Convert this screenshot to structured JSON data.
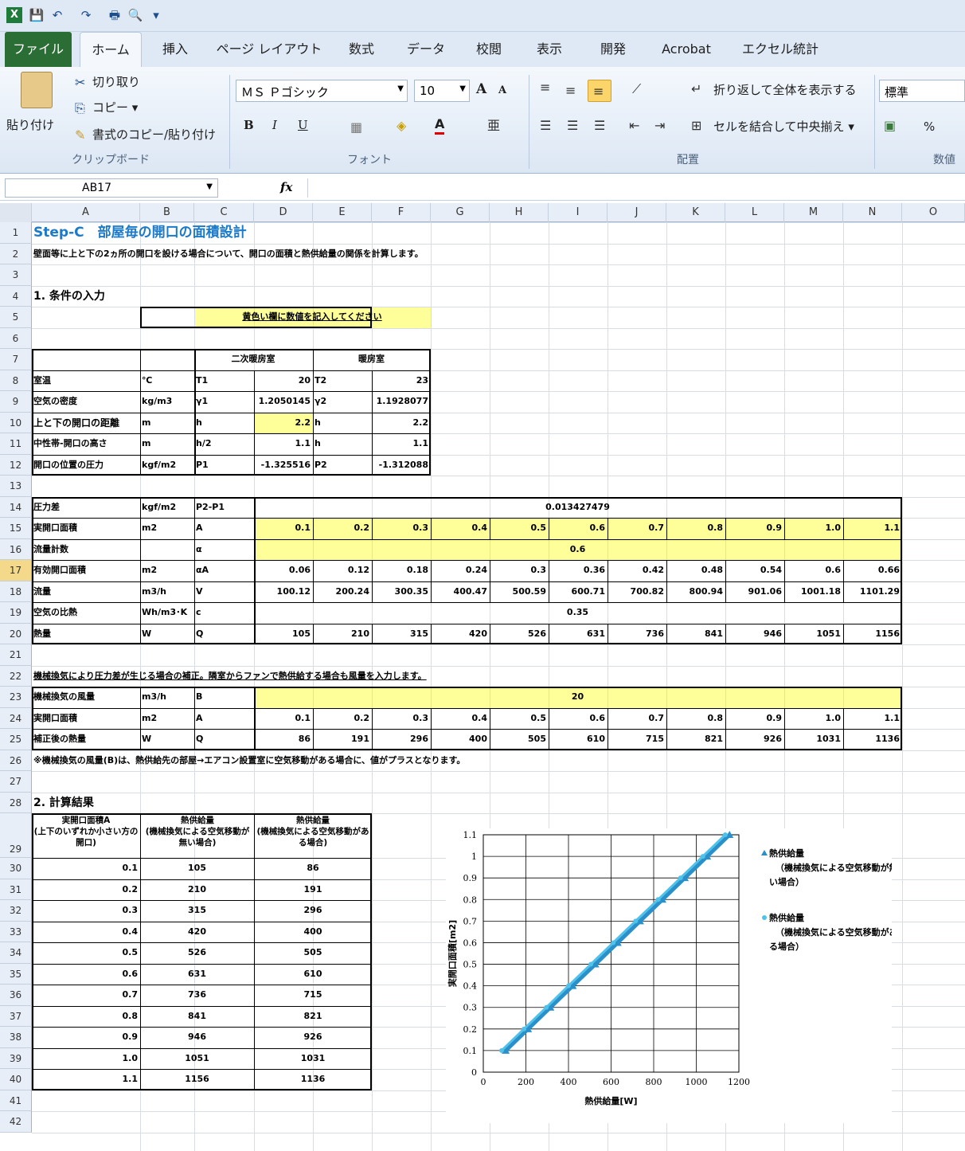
{
  "qat": {
    "excel": "X",
    "save": "💾",
    "undo": "↶",
    "redo": "↷",
    "print": "🖶",
    "preview": "🔍",
    "more": "▾"
  },
  "tabs": [
    "ファイル",
    "ホーム",
    "挿入",
    "ページ レイアウト",
    "数式",
    "データ",
    "校閲",
    "表示",
    "開発",
    "Acrobat",
    "エクセル統計"
  ],
  "ribbon": {
    "paste": "貼り付け",
    "cut": "切り取り",
    "copy": "コピー ▾",
    "format_painter": "書式のコピー/貼り付け",
    "clipboard_group": "クリップボード",
    "font_name": "ＭＳ Ｐゴシック",
    "font_size": "10",
    "grow": "A",
    "shrink": "A",
    "bold": "B",
    "italic": "I",
    "underline": "U",
    "font_group": "フォント",
    "wrap": "折り返して全体を表示する",
    "merge": "セルを結合して中央揃え ▾",
    "align_group": "配置",
    "number_format": "標準",
    "percent": "%",
    "number_group": "数値"
  },
  "formula": {
    "namebox": "AB17",
    "fx": "fx",
    "content": ""
  },
  "cols": [
    "A",
    "B",
    "C",
    "D",
    "E",
    "F",
    "G",
    "H",
    "I",
    "J",
    "K",
    "L",
    "M",
    "N",
    "O"
  ],
  "rows": [
    "1",
    "2",
    "3",
    "4",
    "5",
    "6",
    "7",
    "8",
    "9",
    "10",
    "11",
    "12",
    "13",
    "14",
    "15",
    "16",
    "17",
    "18",
    "19",
    "20",
    "21",
    "22",
    "23",
    "24",
    "25",
    "26",
    "27",
    "28",
    "29",
    "30",
    "31",
    "32",
    "33",
    "34",
    "35",
    "36",
    "37",
    "38",
    "39",
    "40",
    "41",
    "42"
  ],
  "sheet": {
    "title": "Step-C　部屋毎の開口の面積設計",
    "description": "壁面等に上と下の2ヵ所の開口を設ける場合について、開口の面積と熱供給量の関係を計算します。",
    "section1": "1. 条件の入力",
    "note_yellow": "黄色い欄に数値を記入してください",
    "hdr_secondary": "二次暖房室",
    "hdr_heating": "暖房室",
    "cond_rows": [
      {
        "a": "室温",
        "b": "℃",
        "c": "T1",
        "d": "20",
        "e": "T2",
        "f": "23"
      },
      {
        "a": "空気の密度",
        "b": "kg/m3",
        "c": "γ1",
        "d": "1.2050145",
        "e": "γ2",
        "f": "1.1928077"
      },
      {
        "a": "上と下の開口の距離",
        "b": "m",
        "c": "h",
        "d": "2.2",
        "e": "h",
        "f": "2.2"
      },
      {
        "a": "中性帯-開口の高さ",
        "b": "m",
        "c": "h/2",
        "d": "1.1",
        "e": "h",
        "f": "1.1"
      },
      {
        "a": "開口の位置の圧力",
        "b": "kgf/m2",
        "c": "P1",
        "d": "-1.325516",
        "e": "P2",
        "f": "-1.312088"
      }
    ],
    "r14": {
      "a": "圧力差",
      "b": "kgf/m2",
      "c": "P2-P1",
      "v": "0.013427479"
    },
    "r15": {
      "a": "実開口面積",
      "b": "m2",
      "c": "A"
    },
    "r16": {
      "a": "流量計数",
      "c": "α",
      "v": "0.6"
    },
    "r17": {
      "a": "有効開口面積",
      "b": "m2",
      "c": "αA"
    },
    "r18": {
      "a": "流量",
      "b": "m3/h",
      "c": "V"
    },
    "r19": {
      "a": "空気の比熱",
      "b": "Wh/m3･K",
      "c": "c",
      "v": "0.35"
    },
    "r20": {
      "a": "熱量",
      "b": "W",
      "c": "Q"
    },
    "areas": [
      "0.1",
      "0.2",
      "0.3",
      "0.4",
      "0.5",
      "0.6",
      "0.7",
      "0.8",
      "0.9",
      "1.0",
      "1.1"
    ],
    "eff": [
      "0.06",
      "0.12",
      "0.18",
      "0.24",
      "0.3",
      "0.36",
      "0.42",
      "0.48",
      "0.54",
      "0.6",
      "0.66"
    ],
    "flow": [
      "100.12",
      "200.24",
      "300.35",
      "400.47",
      "500.59",
      "600.71",
      "700.82",
      "800.94",
      "901.06",
      "1001.18",
      "1101.29"
    ],
    "heat": [
      "105",
      "210",
      "315",
      "420",
      "526",
      "631",
      "736",
      "841",
      "946",
      "1051",
      "1156"
    ],
    "note22": "機械換気により圧力差が生じる場合の補正。隣室からファンで熱供給する場合も風量を入力します。",
    "r23": {
      "a": "機械換気の風量",
      "b": "m3/h",
      "c": "B",
      "v": "20"
    },
    "r24": {
      "a": "実開口面積",
      "b": "m2",
      "c": "A"
    },
    "r25": {
      "a": "補正後の熱量",
      "b": "W",
      "c": "Q"
    },
    "heat2": [
      "86",
      "191",
      "296",
      "400",
      "505",
      "610",
      "715",
      "821",
      "926",
      "1031",
      "1136"
    ],
    "note26": "※機械換気の風量(B)は、熱供給先の部屋→エアコン設置室に空気移動がある場合に、値がプラスとなります。",
    "section2": "2. 計算結果",
    "res_h1": "実開口面積A\n(上下のいずれか小さい方の開口)",
    "res_h2": "熱供給量\n(機械換気による空気移動が無い場合)",
    "res_h3": "熱供給量\n(機械換気による空気移動がある場合)"
  },
  "chart_data": {
    "type": "line",
    "xlabel": "熱供給量[W]",
    "ylabel": "実開口面積[m2]",
    "xlim": [
      0,
      1200
    ],
    "ylim": [
      0,
      1.1
    ],
    "xticks": [
      "0",
      "200",
      "400",
      "600",
      "800",
      "1000",
      "1200"
    ],
    "yticks": [
      "0",
      "0.1",
      "0.2",
      "0.3",
      "0.4",
      "0.5",
      "0.6",
      "0.7",
      "0.8",
      "0.9",
      "1",
      "1.1"
    ],
    "series": [
      {
        "name": "熱供給量（機械換気による空気移動が無い場合）",
        "color": "#2b8fc9",
        "marker": "triangle",
        "x": [
          105,
          210,
          315,
          420,
          526,
          631,
          736,
          841,
          946,
          1051,
          1156
        ],
        "y": [
          0.1,
          0.2,
          0.3,
          0.4,
          0.5,
          0.6,
          0.7,
          0.8,
          0.9,
          1.0,
          1.1
        ]
      },
      {
        "name": "熱供給量（機械換気による空気移動がある場合）",
        "color": "#4fc2ec",
        "marker": "circle",
        "x": [
          86,
          191,
          296,
          400,
          505,
          610,
          715,
          821,
          926,
          1031,
          1136
        ],
        "y": [
          0.1,
          0.2,
          0.3,
          0.4,
          0.5,
          0.6,
          0.7,
          0.8,
          0.9,
          1.0,
          1.1
        ]
      }
    ],
    "legend": "right"
  }
}
